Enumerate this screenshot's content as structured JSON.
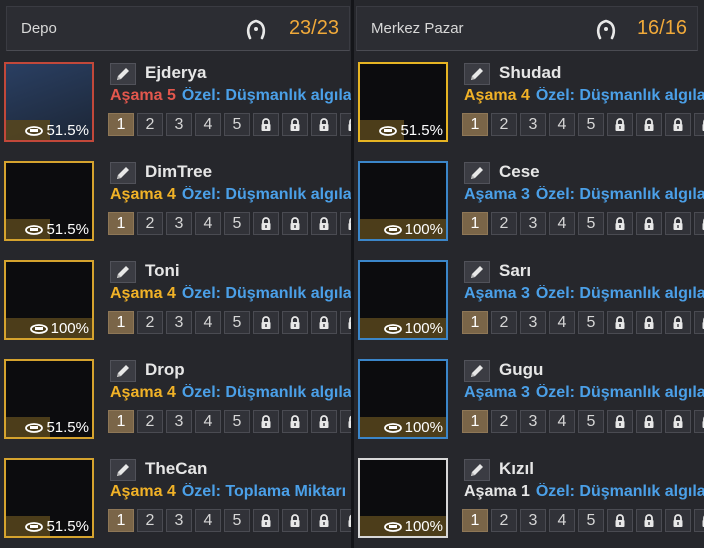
{
  "storage": {
    "title": "Depo",
    "count": "23/23",
    "pets": [
      {
        "name": "Ejderya",
        "stage_label": "Aşama",
        "stage": "5",
        "special": "Özel: Düşmanlık algılar",
        "stamina": "51.5%",
        "stamina_fraction": 0.515,
        "border": "red",
        "tier": "red",
        "art": "dragon-white"
      },
      {
        "name": "DimTree",
        "stage_label": "Aşama",
        "stage": "4",
        "special": "Özel: Düşmanlık algılar",
        "stamina": "51.5%",
        "stamina_fraction": 0.515,
        "border": "gold",
        "tier": "gold",
        "art": "tree"
      },
      {
        "name": "Toni",
        "stage_label": "Aşama",
        "stage": "4",
        "special": "Özel: Düşmanlık algılar",
        "stamina": "100%",
        "stamina_fraction": 1.0,
        "border": "gold",
        "tier": "gold",
        "art": "dog"
      },
      {
        "name": "Drop",
        "stage_label": "Aşama",
        "stage": "4",
        "special": "Özel: Düşmanlık algılar",
        "stamina": "51.5%",
        "stamina_fraction": 0.515,
        "border": "gold",
        "tier": "gold",
        "art": "monkey"
      },
      {
        "name": "TheCan",
        "stage_label": "Aşama",
        "stage": "4",
        "special": "Özel: Toplama Miktarı",
        "stamina": "51.5%",
        "stamina_fraction": 0.515,
        "border": "gold",
        "tier": "gold",
        "art": "hedgehog"
      }
    ]
  },
  "market": {
    "title": "Merkez Pazar",
    "count": "16/16",
    "pets": [
      {
        "name": "Shudad",
        "stage_label": "Aşama",
        "stage": "4",
        "special": "Özel: Düşmanlık algılar",
        "stamina": "51.5%",
        "stamina_fraction": 0.515,
        "border": "gold-bright",
        "tier": "gold",
        "art": "cat-armor"
      },
      {
        "name": "Cese",
        "stage_label": "Aşama",
        "stage": "3",
        "special": "Özel: Düşmanlık algılar",
        "stamina": "100%",
        "stamina_fraction": 1.0,
        "border": "blue",
        "tier": "blue",
        "art": "fox-teal"
      },
      {
        "name": "Sarı",
        "stage_label": "Aşama",
        "stage": "3",
        "special": "Özel: Düşmanlık algılar",
        "stamina": "100%",
        "stamina_fraction": 1.0,
        "border": "blue",
        "tier": "blue",
        "art": "dragon-yellow"
      },
      {
        "name": "Gugu",
        "stage_label": "Aşama",
        "stage": "3",
        "special": "Özel: Düşmanlık algılar",
        "stamina": "100%",
        "stamina_fraction": 1.0,
        "border": "blue",
        "tier": "blue",
        "art": "bird-egg"
      },
      {
        "name": "Kızıl",
        "stage_label": "Aşama",
        "stage": "1",
        "special": "Özel: Düşmanlık algılar",
        "stamina": "100%",
        "stamina_fraction": 1.0,
        "border": "white",
        "tier": "white",
        "art": "dragon-red"
      }
    ]
  },
  "skill_slots": {
    "numbers": [
      "1",
      "2",
      "3",
      "4",
      "5"
    ],
    "active_index": 0,
    "locked_count": 4
  },
  "icons": {
    "header": "stable-horseshoe-icon",
    "edit": "pencil-icon",
    "feed": "feed-bowl-icon",
    "lock": "lock-icon"
  },
  "colors": {
    "gold": "#d5a32e",
    "red": "#c2483a",
    "blue": "#3b86c9",
    "white": "#d8d8d8",
    "count": "#f0a93a",
    "stage_gold": "#f1b227",
    "stage_blue": "#4ba0e8",
    "stage_red": "#e3574d"
  }
}
